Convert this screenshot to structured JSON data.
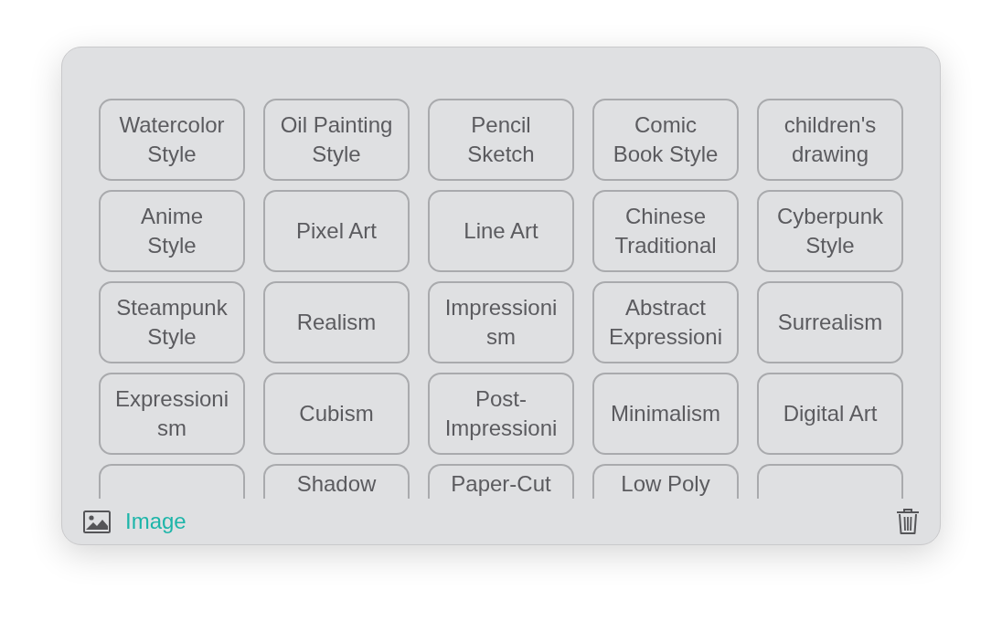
{
  "style_grid": {
    "tiles": [
      {
        "kind": "full",
        "label": "Watercolor Style"
      },
      {
        "kind": "full",
        "label": "Oil Painting Style"
      },
      {
        "kind": "full",
        "label": "Pencil Sketch"
      },
      {
        "kind": "full",
        "label": "Comic Book Style"
      },
      {
        "kind": "full",
        "label": "children's drawing"
      },
      {
        "kind": "full",
        "label": "Anime Style"
      },
      {
        "kind": "full",
        "label": "Pixel Art"
      },
      {
        "kind": "full",
        "label": "Line Art"
      },
      {
        "kind": "full",
        "label": "Chinese Traditional"
      },
      {
        "kind": "full",
        "label": "Cyberpunk Style"
      },
      {
        "kind": "full",
        "label": "Steampunk Style"
      },
      {
        "kind": "full",
        "label": "Realism"
      },
      {
        "kind": "full",
        "label": "Impressionism"
      },
      {
        "kind": "full",
        "label": "Abstract Expressioni"
      },
      {
        "kind": "full",
        "label": "Surrealism"
      },
      {
        "kind": "full",
        "label": "Expressionism"
      },
      {
        "kind": "full",
        "label": "Cubism"
      },
      {
        "kind": "full",
        "label": "Post-Impressioni"
      },
      {
        "kind": "full",
        "label": "Minimalism"
      },
      {
        "kind": "full",
        "label": "Digital Art"
      },
      {
        "kind": "cut"
      },
      {
        "kind": "cut",
        "label": "Shadow"
      },
      {
        "kind": "cut",
        "label": "Paper-Cut"
      },
      {
        "kind": "cut",
        "label": "Low Poly"
      },
      {
        "kind": "cut"
      }
    ]
  },
  "footer": {
    "image_label": "Image"
  }
}
